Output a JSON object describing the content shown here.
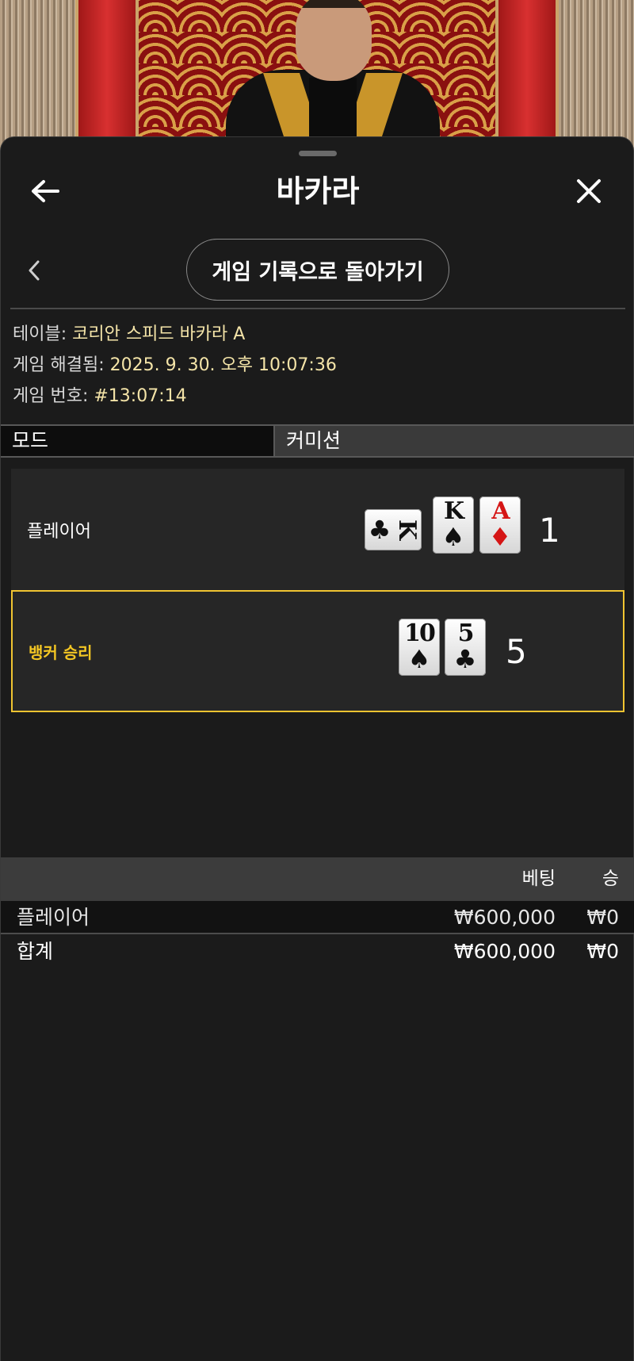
{
  "header": {
    "title": "바카라"
  },
  "history_button": {
    "label": "게임 기록으로 돌아가기"
  },
  "info": {
    "table_label": "테이블: ",
    "table_value": "코리안 스피드 바카라 A",
    "resolved_label": "게임 해결됨: ",
    "resolved_value": "2025. 9. 30. 오후 10:07:36",
    "number_label": "게임 번호: ",
    "number_value": "#13:07:14"
  },
  "mode_row": {
    "mode": "모드",
    "commission": "커미션"
  },
  "player": {
    "label": "플레이어",
    "score": "1",
    "cards": [
      {
        "rank": "K",
        "suit": "♣",
        "color": "#111111",
        "orientation": "sideways"
      },
      {
        "rank": "K",
        "suit": "♠",
        "color": "#111111",
        "orientation": "upright"
      },
      {
        "rank": "A",
        "suit": "♦",
        "color": "#d51515",
        "orientation": "upright"
      }
    ]
  },
  "banker": {
    "label": "뱅커 승리",
    "score": "5",
    "highlight_color": "#f0c431",
    "cards": [
      {
        "rank": "10",
        "suit": "♠",
        "color": "#111111",
        "orientation": "upright"
      },
      {
        "rank": "5",
        "suit": "♣",
        "color": "#111111",
        "orientation": "upright"
      }
    ]
  },
  "bets": {
    "headers": {
      "bet": "베팅",
      "win": "승"
    },
    "rows": [
      {
        "name": "플레이어",
        "bet": "₩600,000",
        "win": "₩0"
      }
    ],
    "total": {
      "name": "합계",
      "bet": "₩600,000",
      "win": "₩0"
    }
  },
  "icons": {
    "back": "arrow-left-icon",
    "close": "close-icon",
    "prev": "chevron-left-icon"
  }
}
